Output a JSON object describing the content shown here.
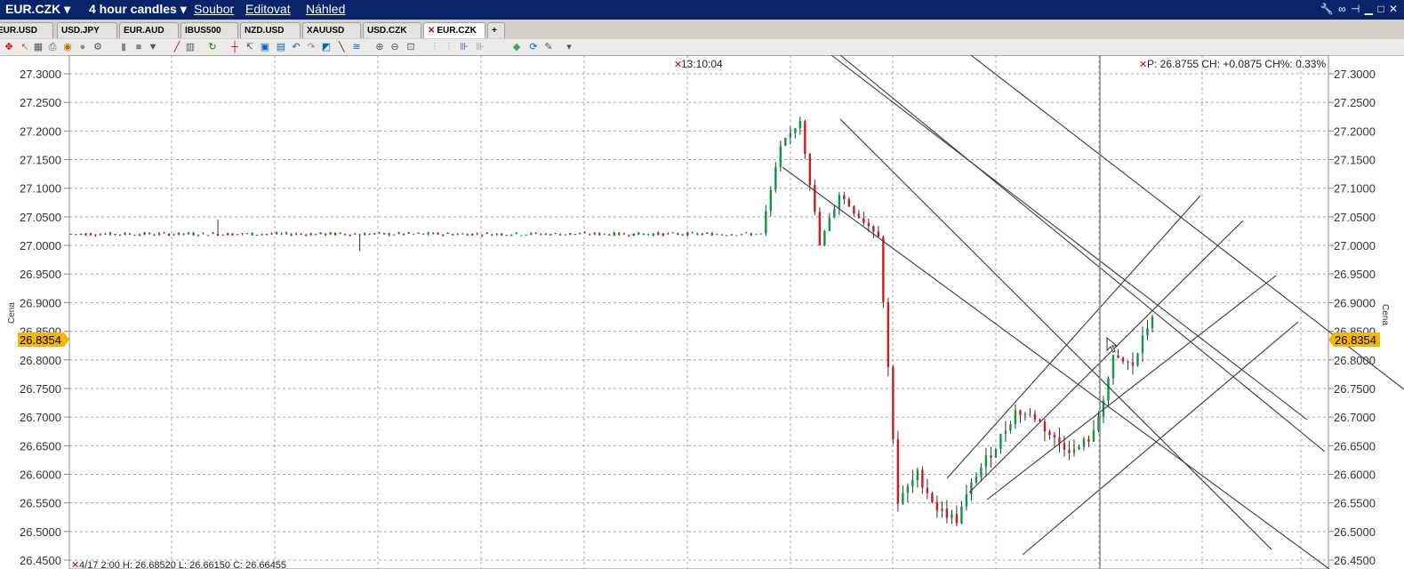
{
  "titlebar": {
    "symbol": "EUR.CZK",
    "period": "4 hour candles",
    "menus": [
      "Soubor",
      "Editovat",
      "Náhled"
    ],
    "bg_color": "#0a246a"
  },
  "tabs": [
    {
      "label": "EUR.USD",
      "active": false
    },
    {
      "label": "USD.JPY",
      "active": false
    },
    {
      "label": "EUR.AUD",
      "active": false
    },
    {
      "label": "IBUS500",
      "active": false
    },
    {
      "label": "NZD.USD",
      "active": false
    },
    {
      "label": "XAUUSD",
      "active": false
    },
    {
      "label": "USD.CZK",
      "active": false
    },
    {
      "label": "EUR.CZK",
      "active": true
    },
    {
      "label": "+",
      "active": false
    }
  ],
  "toolbar_icons": [
    "crosshair-icon",
    "cursor-icon",
    "grid-icon",
    "print-icon",
    "palette-icon",
    "circle-icon",
    "settings-icon",
    "bar-icon",
    "square-icon",
    "dropdown-icon",
    "pencil-icon",
    "bars-icon",
    "refresh-icon",
    "crosshair-add-icon",
    "cursor-line-icon",
    "box-icon",
    "box2-icon",
    "undo-icon",
    "redo-icon",
    "chart-icon",
    "ray-icon",
    "fib-icon",
    "zoom-in-icon",
    "zoom-out-icon",
    "zoom-fit-icon",
    "order-icon",
    "order2-icon",
    "order3-icon",
    "order4-icon",
    "globe-icon",
    "sync-icon",
    "wrench-icon",
    "more-icon"
  ],
  "chart": {
    "time_label": "13:10:04",
    "price_info": "P: 26.8755 CH: +0.0875 CH%: 0.33%",
    "axis_title": "Cena",
    "current_price": "26.8354",
    "ohlc_info": "4/17 2:00  H: 26.68520  L: 26.66150  C: 26.66455",
    "colors": {
      "up": "#0a9a3a",
      "down": "#d21a1a",
      "marker": "#f2b705",
      "grid": "#a8a8a8"
    }
  },
  "chart_data": {
    "type": "candlestick",
    "title": "",
    "ylabel": "Cena",
    "ylim": [
      26.445,
      27.31
    ],
    "y_ticks": [
      "27.3000",
      "27.2500",
      "27.2000",
      "27.1500",
      "27.1000",
      "27.0500",
      "27.0000",
      "26.9500",
      "26.9000",
      "26.8500",
      "26.8000",
      "26.7500",
      "26.7000",
      "26.6500",
      "26.6000",
      "26.5500",
      "26.5000",
      "26.4500"
    ],
    "grid": true,
    "current_price": 26.8354,
    "crosshair_time": "13:10:04",
    "last": {
      "price": 26.8755,
      "change": 0.0875,
      "change_pct": 0.33
    },
    "hover_candle": {
      "time": "4/17 2:00",
      "high": 26.6852,
      "low": 26.6615,
      "close": 26.66455
    },
    "segments": [
      {
        "name": "flat",
        "n": 110,
        "base": 27.02
      },
      {
        "name": "spike",
        "path": [
          27.02,
          27.17,
          27.22,
          27.0,
          27.09,
          27.05,
          27.02
        ]
      },
      {
        "name": "drop",
        "path": [
          27.02,
          26.55,
          26.6,
          26.54,
          26.52,
          26.6,
          26.65,
          26.71,
          26.7,
          26.66,
          26.64,
          26.67,
          26.8,
          26.79,
          26.88
        ]
      }
    ]
  }
}
